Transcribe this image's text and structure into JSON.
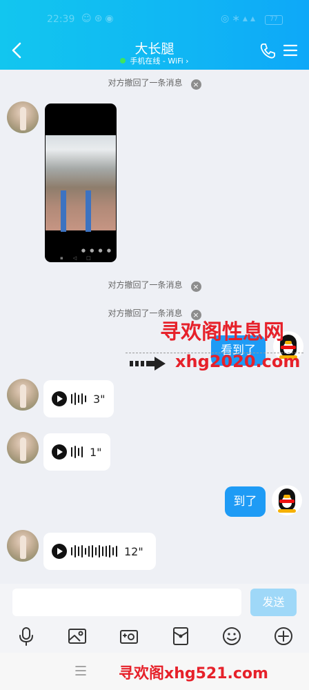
{
  "status": {
    "time": "22:39",
    "left_icons": "☺⊛◉",
    "right_icons": "◎∗▴▴",
    "battery": "77"
  },
  "header": {
    "title": "大长腿",
    "subtitle": "手机在线 - WiFi ›",
    "online_color": "#3fe45f"
  },
  "notices": {
    "recall_1": "对方撤回了一条消息",
    "recall_2": "对方撤回了一条消息",
    "recall_3": "对方撤回了一条消息",
    "close_glyph": "×"
  },
  "video": {
    "controls": "● ● ● ●",
    "nav": "▪◁□"
  },
  "messages": {
    "me_1": "看到了",
    "me_2": "到了",
    "voice_1_duration": "3\"",
    "voice_2_duration": "1\"",
    "voice_3_duration": "12\""
  },
  "watermarks": {
    "top": "寻欢阁性息网",
    "mid": "xhg2020.com",
    "bottom": "寻欢阁xhg521.com"
  },
  "composer": {
    "input_value": "",
    "send_label": "发送"
  },
  "toolbar": {
    "icons": [
      "microphone-icon",
      "image-icon",
      "camera-icon",
      "red-packet-icon",
      "emoji-icon",
      "plus-icon"
    ]
  },
  "colors": {
    "header_gradient": [
      "#12c6ef",
      "#0ea8f8"
    ],
    "my_bubble": "#1e9bf5",
    "send_button": "#9fd8f8",
    "watermark": "#e6212a"
  }
}
